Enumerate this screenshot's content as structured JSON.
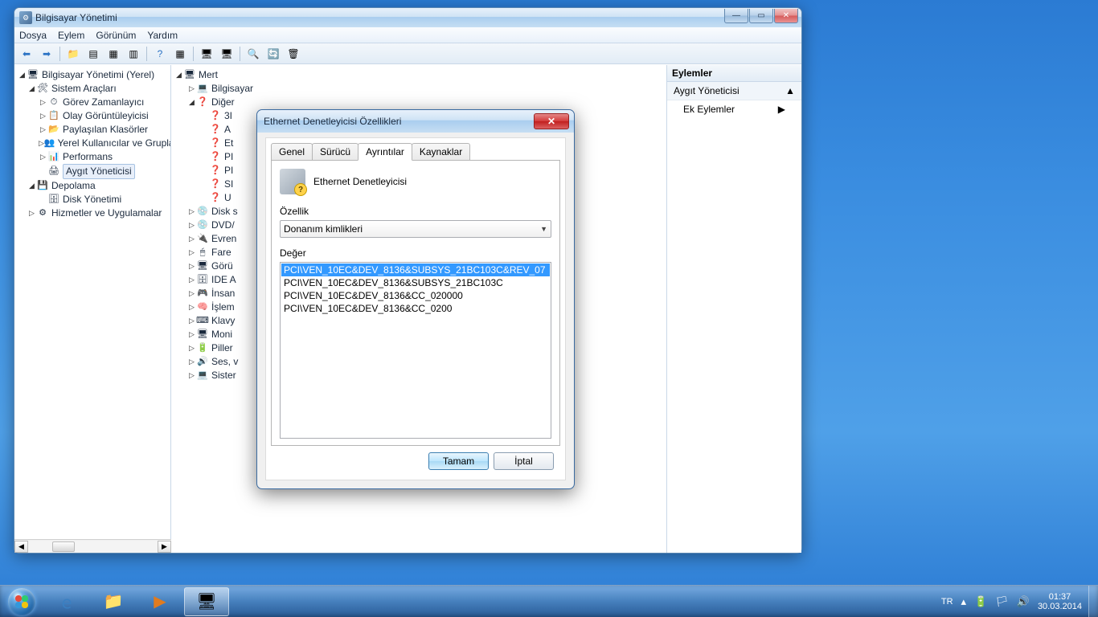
{
  "mgmt": {
    "title": "Bilgisayar Yönetimi",
    "menus": [
      "Dosya",
      "Eylem",
      "Görünüm",
      "Yardım"
    ],
    "nav": {
      "root": "Bilgisayar Yönetimi (Yerel)",
      "tools": "Sistem Araçları",
      "scheduler": "Görev Zamanlayıcı",
      "eventviewer": "Olay Görüntüleyicisi",
      "shared": "Paylaşılan Klasörler",
      "localusers": "Yerel Kullanıcılar ve Gruplar",
      "perf": "Performans",
      "devmgr": "Aygıt Yöneticisi",
      "storage": "Depolama",
      "diskmgmt": "Disk Yönetimi",
      "services": "Hizmetler ve Uygulamalar"
    },
    "dev": {
      "root": "Mert",
      "computer": "Bilgisayar",
      "other": "Diğer",
      "o1": "3I",
      "o2": "A",
      "o3": "Et",
      "o4": "PI",
      "o5": "PI",
      "o6": "SI",
      "o7": "U",
      "disk": "Disk s",
      "dvd": "DVD/",
      "uni": "Evren",
      "mouse": "Fare",
      "disp": "Görü",
      "ide": "IDE A",
      "hid": "İnsan",
      "cpu": "İşlem",
      "kbd": "Klavy",
      "mon": "Moni",
      "bat": "Piller",
      "snd": "Ses, v",
      "sys": "Sister"
    },
    "actions": {
      "header": "Eylemler",
      "section": "Aygıt Yöneticisi",
      "more": "Ek Eylemler"
    }
  },
  "dialog": {
    "title": "Ethernet Denetleyicisi Özellikleri",
    "tabs": {
      "general": "Genel",
      "driver": "Sürücü",
      "details": "Ayrıntılar",
      "resources": "Kaynaklar"
    },
    "device_name": "Ethernet Denetleyicisi",
    "property_label": "Özellik",
    "property_value": "Donanım kimlikleri",
    "value_label": "Değer",
    "values": [
      "PCI\\VEN_10EC&DEV_8136&SUBSYS_21BC103C&REV_07",
      "PCI\\VEN_10EC&DEV_8136&SUBSYS_21BC103C",
      "PCI\\VEN_10EC&DEV_8136&CC_020000",
      "PCI\\VEN_10EC&DEV_8136&CC_0200"
    ],
    "ok": "Tamam",
    "cancel": "İptal"
  },
  "tray": {
    "lang": "TR",
    "time": "01:37",
    "date": "30.03.2014"
  }
}
